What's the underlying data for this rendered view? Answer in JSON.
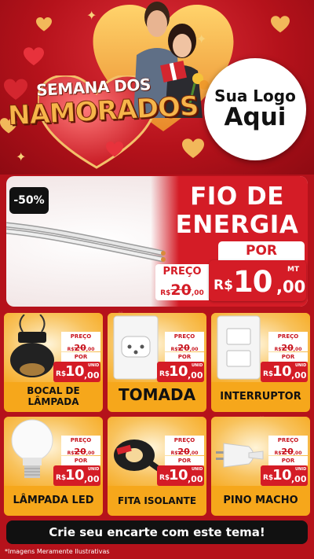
{
  "hero": {
    "headline_line1": "SEMANA DOS",
    "headline_line2": "NAMORADOS",
    "logo_line1": "Sua Logo",
    "logo_line2": "Aqui"
  },
  "featured": {
    "discount": "-50%",
    "title_line1": "FIO DE",
    "title_line2": "ENERGIA",
    "por": "POR",
    "preco": "PREÇO",
    "old_currency": "R$",
    "old_int": "20",
    "old_cents": ",00",
    "currency": "R$",
    "price_int": "10",
    "price_cents": ",00",
    "unit": "MT"
  },
  "products": [
    {
      "name": "BOCAL DE LÂMPADA",
      "preco": "PREÇO",
      "old_currency": "R$",
      "old_int": "20",
      "old_cents": ",00",
      "por": "POR",
      "currency": "R$",
      "price_int": "10",
      "price_cents": ",00",
      "unit": "UNID"
    },
    {
      "name": "TOMADA",
      "preco": "PREÇO",
      "old_currency": "R$",
      "old_int": "20",
      "old_cents": ",00",
      "por": "POR",
      "currency": "R$",
      "price_int": "10",
      "price_cents": ",00",
      "unit": "UNID"
    },
    {
      "name": "INTERRUPTOR",
      "preco": "PREÇO",
      "old_currency": "R$",
      "old_int": "20",
      "old_cents": ",00",
      "por": "POR",
      "currency": "R$",
      "price_int": "10",
      "price_cents": ",00",
      "unit": "UNID"
    },
    {
      "name": "LÂMPADA LED",
      "preco": "PREÇO",
      "old_currency": "R$",
      "old_int": "20",
      "old_cents": ",00",
      "por": "POR",
      "currency": "R$",
      "price_int": "10",
      "price_cents": ",00",
      "unit": "UNID"
    },
    {
      "name": "FITA ISOLANTE",
      "preco": "PREÇO",
      "old_currency": "R$",
      "old_int": "20",
      "old_cents": ",00",
      "por": "POR",
      "currency": "R$",
      "price_int": "10",
      "price_cents": ",00",
      "unit": "UNID"
    },
    {
      "name": "PINO MACHO",
      "preco": "PREÇO",
      "old_currency": "R$",
      "old_int": "20",
      "old_cents": ",00",
      "por": "POR",
      "currency": "R$",
      "price_int": "10",
      "price_cents": ",00",
      "unit": "UNID"
    }
  ],
  "cta": "Crie seu encarte com este tema!",
  "disclaimer": "*Imagens Meramente Ilustrativas",
  "colors": {
    "background": "#b5121b",
    "accent_red": "#d41c26",
    "card_orange": "#f6a71b",
    "gold": "#f6b54a"
  }
}
